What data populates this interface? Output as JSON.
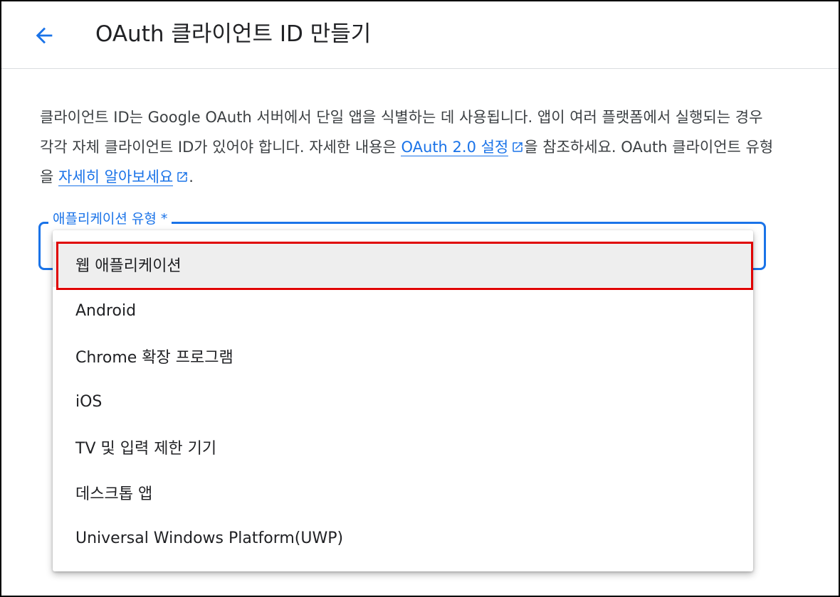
{
  "header": {
    "title": "OAuth 클라이언트 ID 만들기",
    "back_icon": "arrow-back-icon"
  },
  "description": {
    "text1": "클라이언트 ID는 Google OAuth 서버에서 단일 앱을 식별하는 데 사용됩니다. 앱이 여러 플랫폼에서 실행되는 경우 각각 자체 클라이언트 ID가 있어야 합니다. 자세한 내용은 ",
    "link1": "OAuth 2.0 설정",
    "text2": "을 참조하세요. OAuth 클라이언트 유형을 ",
    "link2": "자세히 알아보세요",
    "text3": "."
  },
  "application_type": {
    "label": "애플리케이션 유형 *",
    "options": [
      "웹 애플리케이션",
      "Android",
      "Chrome 확장 프로그램",
      "iOS",
      "TV 및 입력 제한 기기",
      "데스크톱 앱",
      "Universal Windows Platform(UWP)"
    ],
    "highlighted_option": "웹 애플리케이션"
  },
  "colors": {
    "accent": "#1a73e8",
    "highlight_border": "#e00000",
    "text": "#202124"
  }
}
